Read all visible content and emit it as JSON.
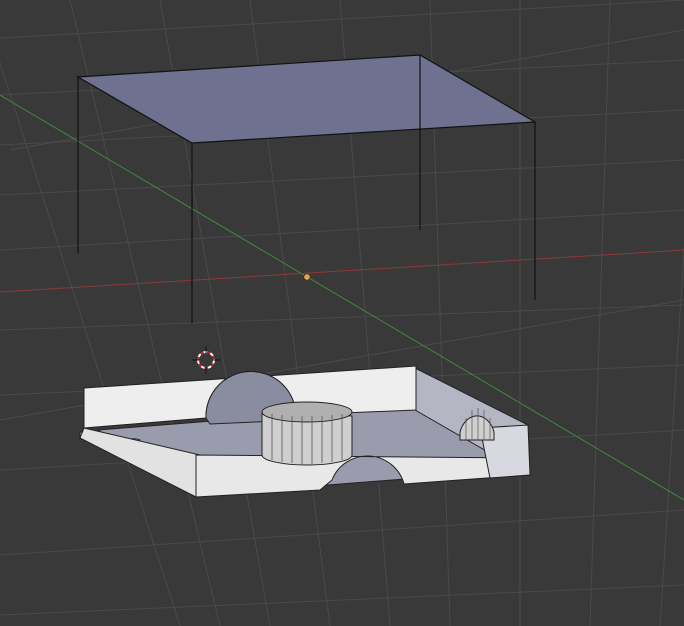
{
  "viewport": {
    "view": "3D Viewport",
    "colors": {
      "background": "#393939",
      "grid": "#4a4a4a",
      "x_axis": "#8b3a3a",
      "y_axis": "#3f8a3f",
      "origin": "#e8a050",
      "wire": "#111111",
      "lid_face": "#6e7190",
      "base_top": "#eeeeee",
      "base_inner": "#9a9cae",
      "base_side": "#d6d6d6"
    }
  },
  "objects": [
    {
      "name": "lid-wire-box",
      "type": "mesh"
    },
    {
      "name": "base-tray",
      "type": "mesh"
    }
  ],
  "cursor": {
    "icon": "3d-cursor-icon"
  },
  "origin": {
    "icon": "object-origin-dot"
  }
}
